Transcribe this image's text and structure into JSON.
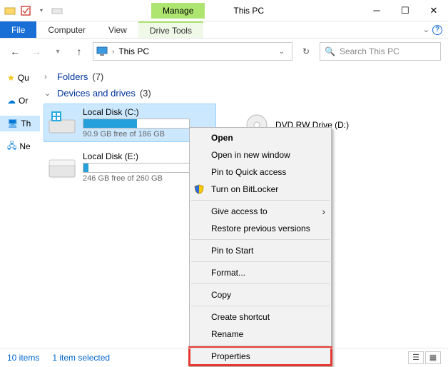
{
  "titlebar": {
    "manage_label": "Manage",
    "title": "This PC"
  },
  "ribbon": {
    "file": "File",
    "computer": "Computer",
    "view": "View",
    "drive_tools": "Drive Tools"
  },
  "nav": {
    "location": "This PC",
    "search_placeholder": "Search This PC"
  },
  "sidebar": {
    "items": [
      {
        "label": "Qu"
      },
      {
        "label": "Or"
      },
      {
        "label": "Th"
      },
      {
        "label": "Ne"
      }
    ]
  },
  "groups": {
    "folders": {
      "label": "Folders",
      "count_label": "(7)"
    },
    "drives": {
      "label": "Devices and drives",
      "count_label": "(3)"
    }
  },
  "drives": [
    {
      "name": "Local Disk (C:)",
      "free_text": "90.9 GB free of 186 GB",
      "fill_pct": 51
    },
    {
      "name": "Local Disk (E:)",
      "free_text": "246 GB free of 260 GB",
      "fill_pct": 5
    }
  ],
  "dvd": {
    "name": "DVD RW Drive (D:)"
  },
  "context_menu": {
    "open": "Open",
    "open_new": "Open in new window",
    "pin_quick": "Pin to Quick access",
    "bitlocker": "Turn on BitLocker",
    "give_access": "Give access to",
    "restore": "Restore previous versions",
    "pin_start": "Pin to Start",
    "format": "Format...",
    "copy": "Copy",
    "shortcut": "Create shortcut",
    "rename": "Rename",
    "properties": "Properties"
  },
  "status": {
    "items": "10 items",
    "selected": "1 item selected"
  }
}
